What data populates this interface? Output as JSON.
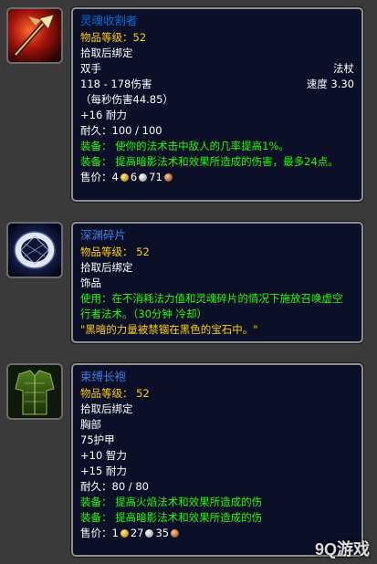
{
  "items": [
    {
      "name": "灵魂收割者",
      "item_level": "物品等级：52",
      "bind": "拾取后绑定",
      "slot": "双手",
      "type": "法杖",
      "damage": "118 - 178伤害",
      "speed": "速度 3.30",
      "dps": "（每秒伤害44.85）",
      "stat1": "+16 耐力",
      "durability": "耐久：100 / 100",
      "equip1": "装备： 使你的法术击中敌人的几率提高1%。",
      "equip2": "装备： 提高暗影法术和效果所造成的伤害，最多24点。",
      "sell_label": "售价：",
      "gold": "4",
      "silver": "6",
      "copper": "71"
    },
    {
      "name": "深渊碎片",
      "item_level": "物品等级： 52",
      "bind": "拾取后绑定",
      "slot": "饰品",
      "use_line1": "使用：在不消耗法力值和灵魂碎片的情况下施放召唤虚空",
      "use_line2": "行者法术。（30分钟 冷却）",
      "flavor": "\"黑暗的力量被禁锢在黑色的宝石中。\""
    },
    {
      "name": "束缚长袍",
      "item_level": "物品等级： 52",
      "bind": "拾取后绑定",
      "slot": "胸部",
      "armor": "75护甲",
      "stat1": "+10 智力",
      "stat2": "+15 耐力",
      "durability": "耐久：80 / 80",
      "equip1": "装备： 提高火焰法术和效果所造成的伤",
      "equip2": "装备： 提高暗影法术和效果所造成的伤",
      "sell_label": "售价：",
      "gold": "1",
      "silver": "27",
      "copper": "35"
    }
  ],
  "watermark": "9Q游戏",
  "colors": {
    "item_name": "#0070dd",
    "gold_text": "#ffd100",
    "equip_text": "#1eff00",
    "tooltip_bg": "#0a0e28",
    "border": "#8d8f96"
  }
}
